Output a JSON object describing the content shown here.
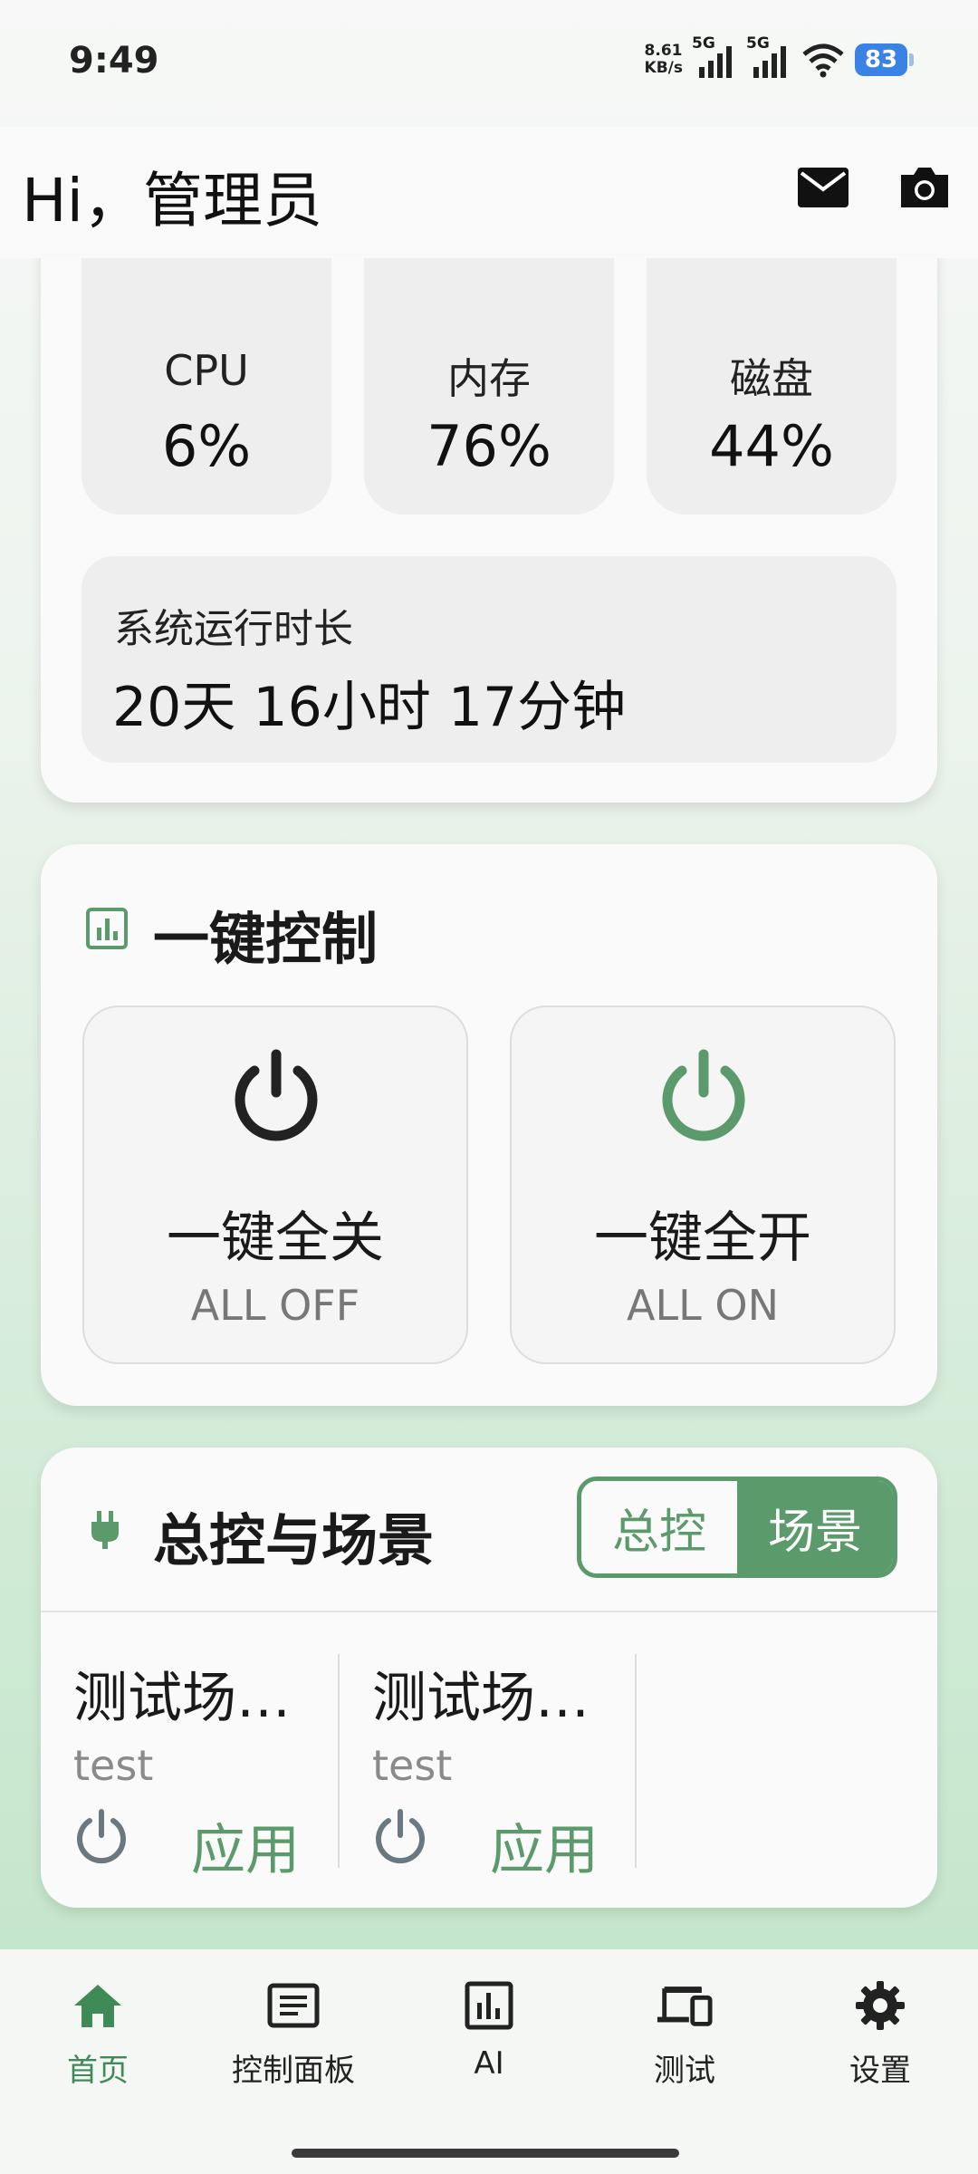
{
  "status_bar": {
    "time": "9:49",
    "net_speed_value": "8.61",
    "net_speed_unit": "KB/s",
    "sim1": "5G",
    "sim2": "5G",
    "battery": "83"
  },
  "header": {
    "greeting": "Hi，管理员",
    "icons": [
      "mail-icon",
      "camera-icon"
    ]
  },
  "system_status": {
    "metrics": [
      {
        "label": "CPU",
        "value": "6%",
        "fraction": 0.06
      },
      {
        "label": "内存",
        "value": "76%",
        "fraction": 0.76
      },
      {
        "label": "磁盘",
        "value": "44%",
        "fraction": 0.44
      }
    ],
    "uptime_label": "系统运行时长",
    "uptime_value": "20天 16小时 17分钟"
  },
  "one_key_control": {
    "title": "一键控制",
    "all_off": {
      "title": "一键全关",
      "subtitle": "ALL OFF"
    },
    "all_on": {
      "title": "一键全开",
      "subtitle": "ALL ON"
    }
  },
  "scenes": {
    "title": "总控与场景",
    "toggle": {
      "option_master": "总控",
      "option_scene": "场景",
      "selected": "场景"
    },
    "items": [
      {
        "name": "测试场…",
        "desc": "test",
        "apply": "应用"
      },
      {
        "name": "测试场…",
        "desc": "test",
        "apply": "应用"
      }
    ]
  },
  "bottom_nav": {
    "items": [
      {
        "label": "首页",
        "icon": "home-icon",
        "active": true
      },
      {
        "label": "控制面板",
        "icon": "panel-icon",
        "active": false
      },
      {
        "label": "AI",
        "icon": "chart-icon",
        "active": false
      },
      {
        "label": "测试",
        "icon": "devices-icon",
        "active": false
      },
      {
        "label": "设置",
        "icon": "gear-icon",
        "active": false
      }
    ]
  },
  "colors": {
    "accent": "#5b9a6a",
    "nav_active": "#3f8a57",
    "ring_track": "#dcdcdc",
    "battery": "#3b82e6"
  }
}
